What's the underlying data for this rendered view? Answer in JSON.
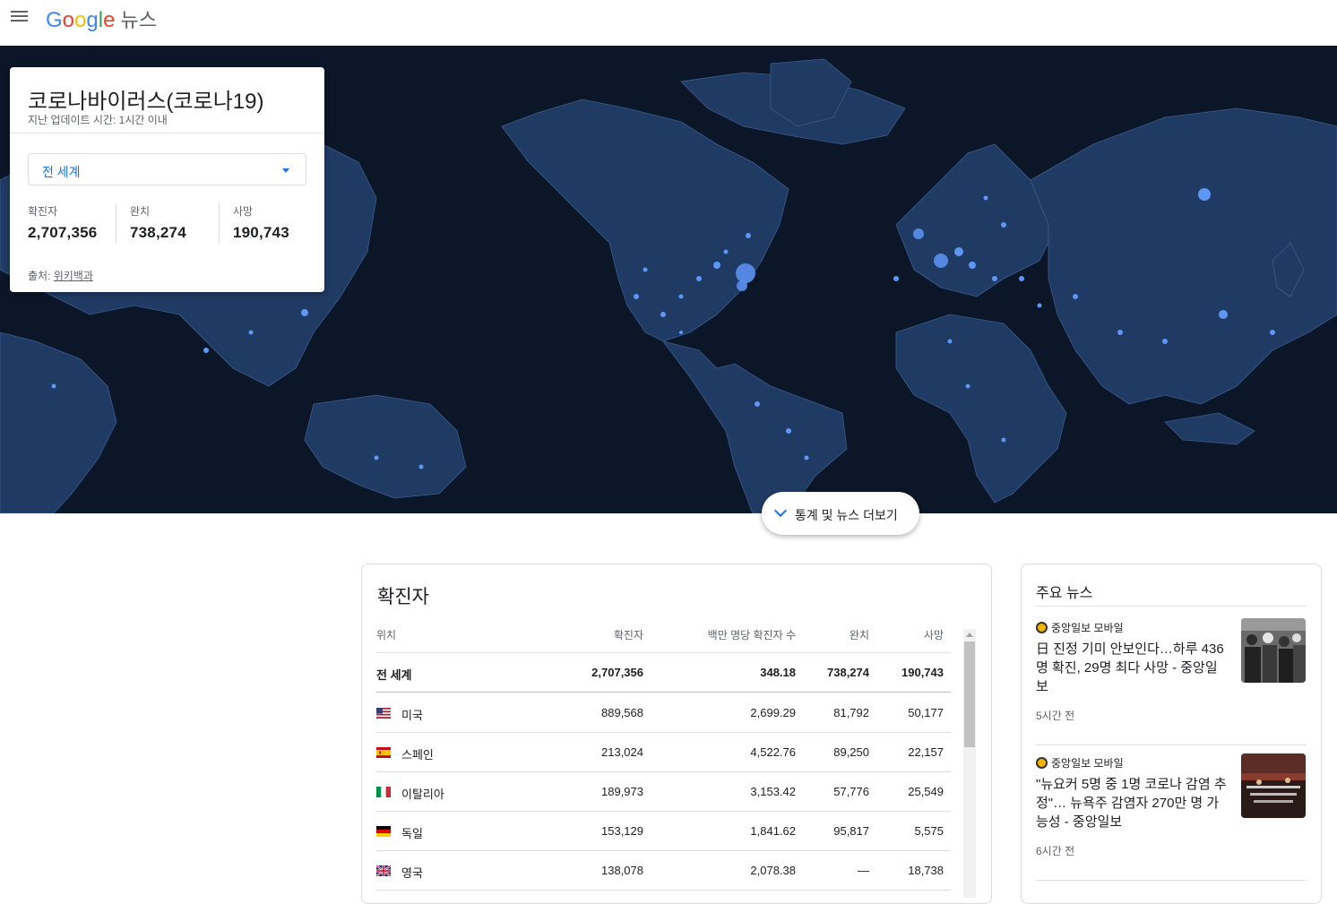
{
  "header": {
    "logo_letters": [
      "G",
      "o",
      "o",
      "g",
      "l",
      "e"
    ],
    "product": "뉴스"
  },
  "colors": {
    "map_ocean": "#0b1628",
    "map_land": "#1f3a63",
    "map_dot": "#5e97f6",
    "accent": "#1a73e8"
  },
  "summary_card": {
    "title": "코로나바이러스(코로나19)",
    "updated": "지난 업데이트 시간: 1시간 이내",
    "region_selected": "전 세계",
    "stats": [
      {
        "label": "확진자",
        "value": "2,707,356"
      },
      {
        "label": "완치",
        "value": "738,274"
      },
      {
        "label": "사망",
        "value": "190,743"
      }
    ],
    "source_prefix": "출처: ",
    "source_link": "위키백과"
  },
  "more_button": "통계 및 뉴스 더보기",
  "cases_table": {
    "title": "확진자",
    "columns": [
      "위치",
      "확진자",
      "백만 명당 확진자 수",
      "완치",
      "사망"
    ],
    "world_row": {
      "location": "전 세계",
      "confirmed": "2,707,356",
      "per_million": "348.18",
      "recovered": "738,274",
      "deaths": "190,743"
    },
    "rows": [
      {
        "location": "미국",
        "flag": "us-flag",
        "confirmed": "889,568",
        "per_million": "2,699.29",
        "recovered": "81,792",
        "deaths": "50,177"
      },
      {
        "location": "스페인",
        "flag": "es-flag",
        "confirmed": "213,024",
        "per_million": "4,522.76",
        "recovered": "89,250",
        "deaths": "22,157"
      },
      {
        "location": "이탈리아",
        "flag": "it-flag",
        "confirmed": "189,973",
        "per_million": "3,153.42",
        "recovered": "57,776",
        "deaths": "25,549"
      },
      {
        "location": "독일",
        "flag": "de-flag",
        "confirmed": "153,129",
        "per_million": "1,841.62",
        "recovered": "95,817",
        "deaths": "5,575"
      },
      {
        "location": "영국",
        "flag": "gb-flag",
        "confirmed": "138,078",
        "per_million": "2,078.38",
        "recovered": "—",
        "deaths": "18,738"
      }
    ]
  },
  "news": {
    "title": "주요 뉴스",
    "items": [
      {
        "publisher": "중앙일보 모바일",
        "headline": "日 진정 기미 안보인다…하루 436명 확진, 29명 최다 사망 - 중앙일보",
        "time": "5시간 전",
        "thumb": "crowd-photo"
      },
      {
        "publisher": "중앙일보 모바일",
        "headline": "\"뉴요커 5명 중 1명 코로나 감염 추정\"… 뉴욕주 감염자 270만 명 가능성 - 중앙일보",
        "time": "6시간 전",
        "thumb": "street-photo"
      }
    ]
  }
}
